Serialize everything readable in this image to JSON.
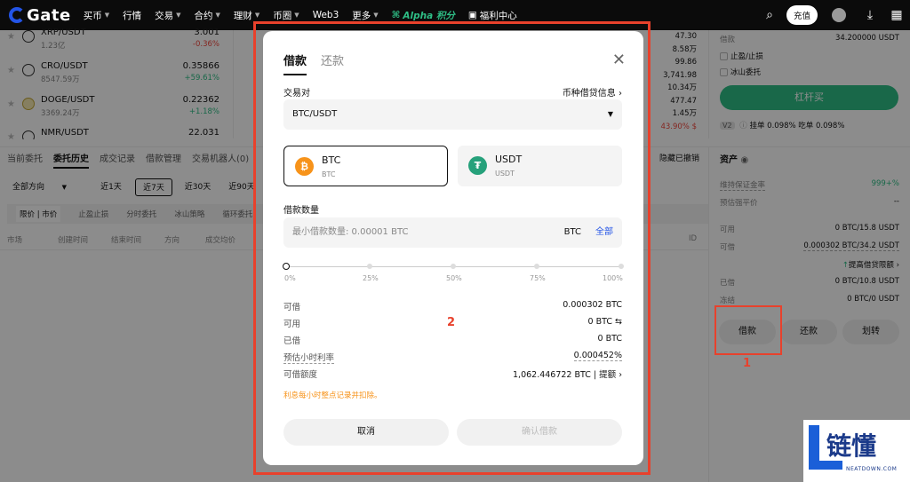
{
  "nav": {
    "logo": "Gate",
    "items": [
      {
        "label": "买币",
        "caret": true
      },
      {
        "label": "行情",
        "caret": false
      },
      {
        "label": "交易",
        "caret": true
      },
      {
        "label": "合约",
        "caret": true
      },
      {
        "label": "理财",
        "caret": true
      },
      {
        "label": "币圈",
        "caret": true
      },
      {
        "label": "Web3",
        "caret": false
      },
      {
        "label": "更多",
        "caret": true
      }
    ],
    "alpha": "Alpha 积分",
    "welfare": "福利中心",
    "deposit": "充值"
  },
  "markets": [
    {
      "pair": "XRP/USDT",
      "vol": "1.23亿",
      "price": "3.001",
      "change": "-0.36%",
      "dir": "down"
    },
    {
      "pair": "CRO/USDT",
      "vol": "8547.59万",
      "price": "0.35866",
      "change": "+59.61%",
      "dir": "up"
    },
    {
      "pair": "DOGE/USDT",
      "vol": "3369.24万",
      "price": "0.22362",
      "change": "+1.18%",
      "dir": "up"
    },
    {
      "pair": "NMR/USDT",
      "vol": "",
      "price": "22.031",
      "change": "",
      "dir": "up"
    }
  ],
  "orderbook": [
    "47.30",
    "8.58万",
    "99.86",
    "3,741.98",
    "10.34万",
    "477.47",
    "1.45万"
  ],
  "orderbook_pct": "43.90% $",
  "trade_panel": {
    "borrow_label": "借款",
    "borrow_value": "34.200000 USDT",
    "tp_sl": "止盈/止损",
    "iceberg": "冰山委托",
    "buy_button": "杠杆买",
    "vip": "V2",
    "fees": "挂单 0.098%  吃单 0.098%"
  },
  "history": {
    "tabs": [
      "当前委托",
      "委托历史",
      "成交记录",
      "借款管理",
      "交易机器人(0)"
    ],
    "hide_label": "隐藏已撤销",
    "direction": "全部方向",
    "ranges": [
      "近1天",
      "近7天",
      "近30天",
      "近90天"
    ],
    "types": [
      "限价 | 市价",
      "止盈止损",
      "分时委托",
      "冰山策略",
      "循环委托"
    ],
    "columns": [
      "市场",
      "创建时间",
      "结束时间",
      "方向",
      "成交均价",
      "ID"
    ]
  },
  "assets": {
    "title": "资产",
    "maintenance_label": "维持保证金率",
    "maintenance_value": "999+%",
    "liq_label": "预估强平价",
    "liq_value": "--",
    "rows": [
      {
        "label": "可用",
        "value": "0 BTC/15.8 USDT"
      },
      {
        "label": "可借",
        "value": "0.000302 BTC/34.2 USDT"
      },
      {
        "label": "已借",
        "value": "0 BTC/10.8 USDT"
      },
      {
        "label": "冻结",
        "value": "0 BTC/0 USDT"
      }
    ],
    "raise_limit": "提高借贷限额",
    "buttons": [
      "借款",
      "还款",
      "划转"
    ],
    "annotation": "1"
  },
  "modal": {
    "tab_borrow": "借款",
    "tab_repay": "还款",
    "pair_label": "交易对",
    "coin_info": "币种借贷信息",
    "pair_value": "BTC/USDT",
    "coins": [
      {
        "name": "BTC",
        "sub": "BTC",
        "icon": "₿",
        "color": "#f7931a"
      },
      {
        "name": "USDT",
        "sub": "USDT",
        "icon": "₮",
        "color": "#26a17b"
      }
    ],
    "amount_label": "借款数量",
    "amount_placeholder": "最小借款数量: 0.00001 BTC",
    "amount_unit": "BTC",
    "all_label": "全部",
    "slider_position": 0,
    "slider_ticks": [
      "0%",
      "25%",
      "50%",
      "75%",
      "100%"
    ],
    "info": [
      {
        "label": "可借",
        "value": "0.000302 BTC"
      },
      {
        "label": "可用",
        "value": "0 BTC ⇆"
      },
      {
        "label": "已借",
        "value": "0 BTC"
      },
      {
        "label": "预估小时利率",
        "value": "0.000452%"
      },
      {
        "label": "可借额度",
        "value": "1,062.446722 BTC"
      }
    ],
    "quota_link": "提额",
    "note": "利息每小时整点记录并扣除。",
    "cancel": "取消",
    "confirm": "确认借款",
    "annotation": "2"
  },
  "watermark": {
    "brand": "链懂",
    "domain": "NEATDOWN.COM"
  }
}
